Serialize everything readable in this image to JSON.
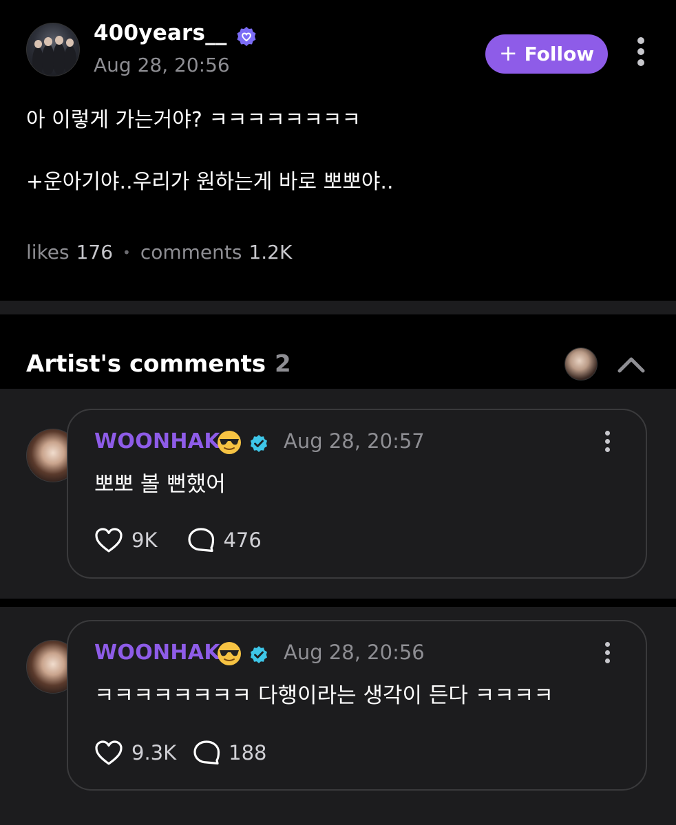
{
  "post": {
    "author": "400years__",
    "time": "Aug 28, 20:56",
    "follow_label": "Follow",
    "body_line1": "아 이렇게 가는거야? ㅋㅋㅋㅋㅋㅋㅋㅋ",
    "body_line2": "+운아기야..우리가 원하는게 바로 뽀뽀야..",
    "likes_label": "likes",
    "likes_count": "176",
    "comments_label": "comments",
    "comments_count": "1.2K",
    "icons": {
      "verified": "verified-heart-icon",
      "more": "more-vertical-icon",
      "plus": "plus-icon"
    },
    "colors": {
      "accent": "#8e5ce8",
      "badge": "#7b6cf6"
    }
  },
  "artist_comments": {
    "title": "Artist's comments",
    "count": "2",
    "icons": {
      "collapse": "chevron-up-icon"
    },
    "items": [
      {
        "name": "WOONHAK",
        "time": "Aug 28, 20:57",
        "text": "뽀뽀 볼 뻔했어",
        "likes": "9K",
        "replies": "476"
      },
      {
        "name": "WOONHAK",
        "time": "Aug 28, 20:56",
        "text": "ㅋㅋㅋㅋㅋㅋㅋㅋ 다행이라는 생각이 든다 ㅋㅋㅋㅋ",
        "likes": "9.3K",
        "replies": "188"
      }
    ],
    "colors": {
      "name": "#8e5ce8",
      "check": "#3ec6e8"
    }
  }
}
